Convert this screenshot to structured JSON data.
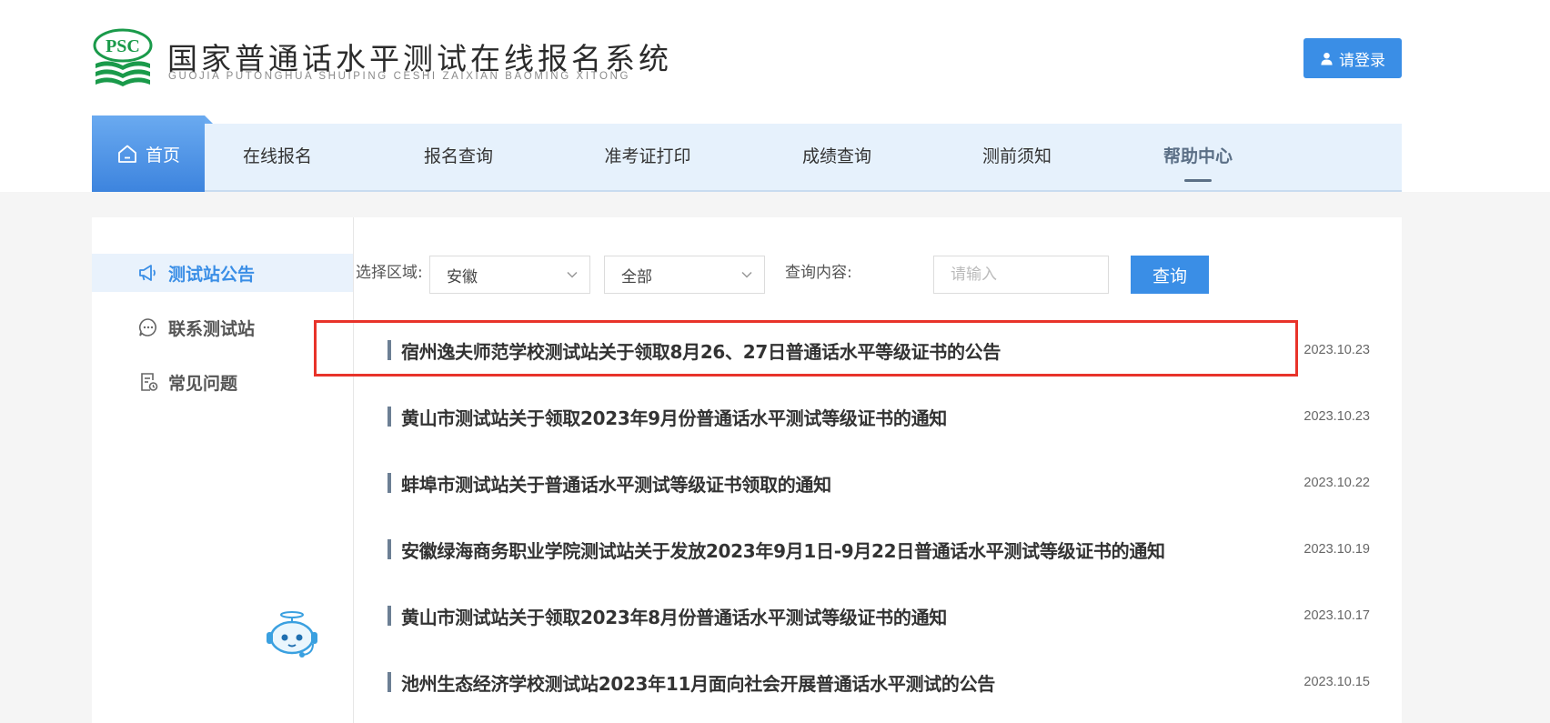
{
  "header": {
    "logo_text": "PSC",
    "title": "国家普通话水平测试在线报名系统",
    "subtitle": "GUOJIA PUTONGHUA SHUIPING CESHI ZAIXIAN BAOMING XITONG",
    "login_label": "请登录",
    "colors": {
      "accent": "#3a8ee6",
      "logo_green": "#1a9a4a"
    }
  },
  "nav": {
    "items": [
      {
        "label": "首页",
        "icon": "home-icon"
      },
      {
        "label": "在线报名"
      },
      {
        "label": "报名查询"
      },
      {
        "label": "准考证打印"
      },
      {
        "label": "成绩查询"
      },
      {
        "label": "测前须知"
      },
      {
        "label": "帮助中心"
      }
    ],
    "active": "帮助中心"
  },
  "sidebar": {
    "items": [
      {
        "label": "测试站公告",
        "icon": "megaphone-icon",
        "active": true
      },
      {
        "label": "联系测试站",
        "icon": "chat-icon"
      },
      {
        "label": "常见问题",
        "icon": "document-clock-icon"
      }
    ],
    "assistant_icon": "robot-assistant-icon"
  },
  "filter": {
    "region_label": "选择区域:",
    "region_value": "安徽",
    "category_value": "全部",
    "query_label": "查询内容:",
    "query_placeholder": "请输入",
    "search_label": "查询"
  },
  "notices": [
    {
      "title": "宿州逸夫师范学校测试站关于领取8月26、27日普通话水平等级证书的公告",
      "date": "2023.10.23",
      "highlighted": true
    },
    {
      "title": "黄山市测试站关于领取2023年9月份普通话水平测试等级证书的通知",
      "date": "2023.10.23"
    },
    {
      "title": "蚌埠市测试站关于普通话水平测试等级证书领取的通知",
      "date": "2023.10.22"
    },
    {
      "title": "安徽绿海商务职业学院测试站关于发放2023年9月1日-9月22日普通话水平测试等级证书的通知",
      "date": "2023.10.19"
    },
    {
      "title": "黄山市测试站关于领取2023年8月份普通话水平测试等级证书的通知",
      "date": "2023.10.17"
    },
    {
      "title": "池州生态经济学校测试站2023年11月面向社会开展普通话水平测试的公告",
      "date": "2023.10.15"
    }
  ]
}
